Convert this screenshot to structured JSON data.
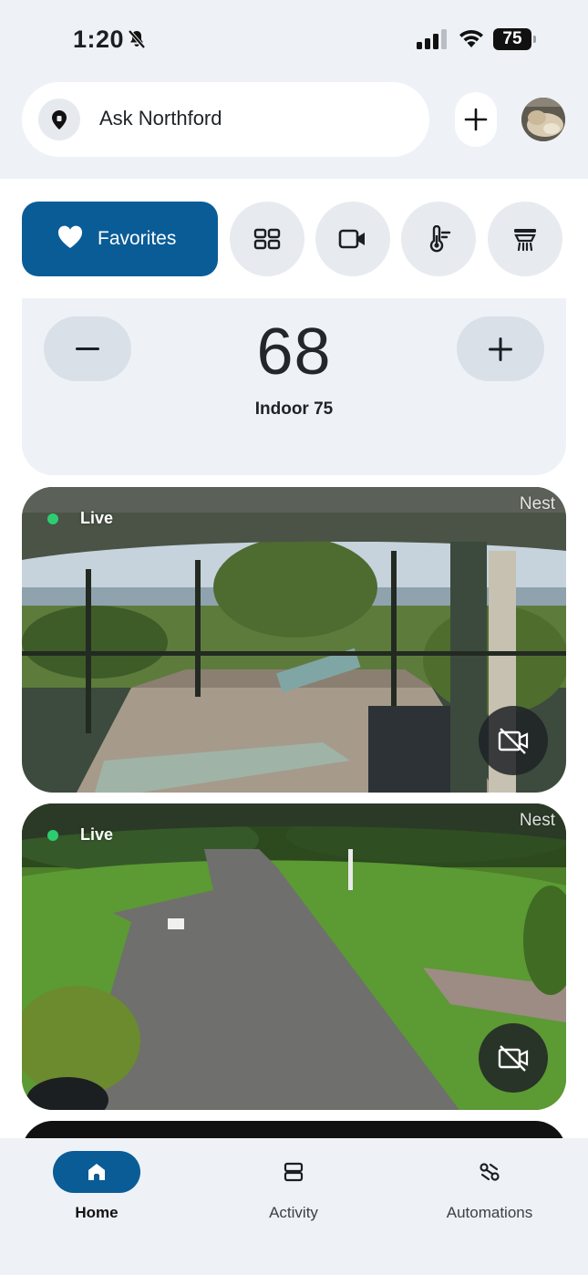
{
  "status_bar": {
    "time": "1:20",
    "battery": "75"
  },
  "header": {
    "search_label": "Ask Northford"
  },
  "filters": {
    "favorites_label": "Favorites"
  },
  "thermostat": {
    "setpoint": "68",
    "indoor": "Indoor 75"
  },
  "cameras": [
    {
      "live_label": "Live",
      "brand": "Nest"
    },
    {
      "live_label": "Live",
      "brand": "Nest"
    }
  ],
  "nav": {
    "items": [
      {
        "label": "Home",
        "icon": "home-icon"
      },
      {
        "label": "Activity",
        "icon": "activity-icon"
      },
      {
        "label": "Automations",
        "icon": "automations-icon"
      }
    ]
  },
  "colors": {
    "accent": "#0a5c97",
    "live": "#2ecc71",
    "background": "#eef2f6"
  }
}
